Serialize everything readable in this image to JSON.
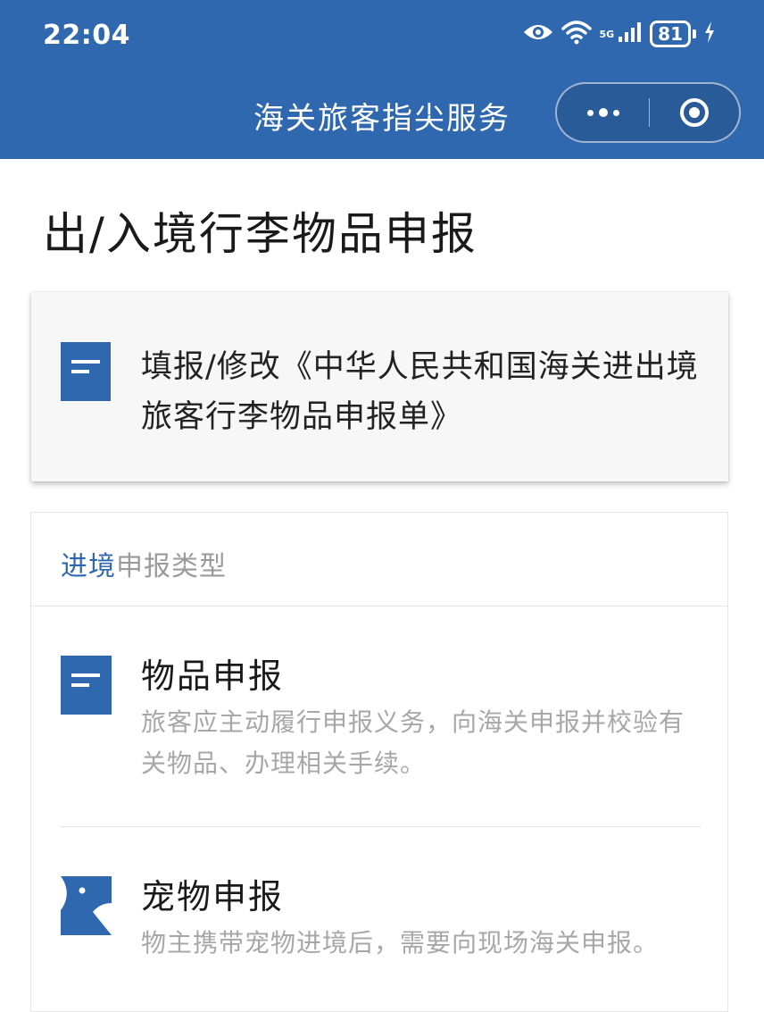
{
  "status_bar": {
    "time": "22:04",
    "signal_label": "5G",
    "battery": "81"
  },
  "navbar": {
    "title": "海关旅客指尖服务",
    "more_icon": "more-dots-icon",
    "close_icon": "miniprogram-close-icon"
  },
  "page": {
    "title": "出/入境行李物品申报"
  },
  "form_card": {
    "text": "填报/修改《中华人民共和国海关进出境旅客行李物品申报单》",
    "icon": "document-icon"
  },
  "entry_section": {
    "header_highlight": "进境",
    "header_rest": "申报类型",
    "items": [
      {
        "title": "物品申报",
        "desc": "旅客应主动履行申报义务，向海关申报并校验有关物品、办理相关手续。",
        "icon": "document-icon"
      },
      {
        "title": "宠物申报",
        "desc": "物主携带宠物进境后，需要向现场海关申报。",
        "icon": "pet-icon"
      }
    ]
  },
  "colors": {
    "brand": "#2f68ae",
    "muted_text": "#a7a7a7"
  }
}
